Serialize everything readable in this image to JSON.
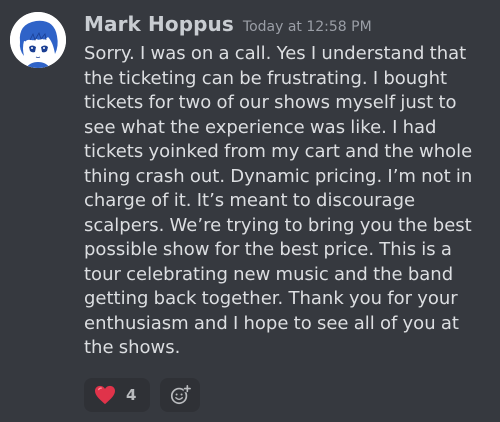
{
  "message": {
    "username": "Mark Hoppus",
    "timestamp": "Today at 12:58 PM",
    "avatar_icon": "anime-avatar-icon",
    "text": "Sorry. I was on a call. Yes I understand that the ticketing can be frustrating. I bought tickets for two of our shows myself just to see what the experience was like. I had tickets yoinked from my cart and the whole thing crash out. Dynamic pricing. I’m not in charge of it. It’s meant to discourage scalpers. We’re trying to bring you the best possible show for the best price. This is a tour celebrating new music and the band getting back together. Thank you for your enthusiasm and I hope to see all of you at the shows."
  },
  "reactions": [
    {
      "icon": "red-heart-icon",
      "count": "4"
    }
  ],
  "add_reaction_icon": "add-reaction-icon",
  "colors": {
    "background": "#36393f",
    "username": "#c9cdd2",
    "timestamp": "#9a9ea6",
    "text": "#dcdee1",
    "reaction_bg": "#2f3136",
    "heart": "#e0334a"
  }
}
